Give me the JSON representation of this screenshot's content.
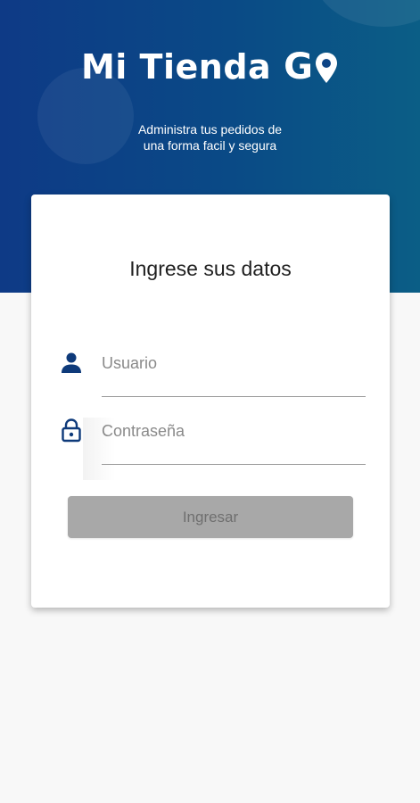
{
  "header": {
    "brand_name": "Mi Tienda",
    "brand_suffix": "G",
    "tagline_line1": "Administra tus pedidos de",
    "tagline_line2": "una forma facil y segura",
    "colors": {
      "hero_start": "#0e3a86",
      "hero_end": "#0b5e86",
      "icon": "#0e3a7a"
    }
  },
  "login": {
    "title": "Ingrese sus datos",
    "username": {
      "placeholder": "Usuario",
      "value": "",
      "icon": "person-icon"
    },
    "password": {
      "placeholder": "Contraseña",
      "value": "",
      "icon": "lock-icon"
    },
    "submit_label": "Ingresar"
  }
}
